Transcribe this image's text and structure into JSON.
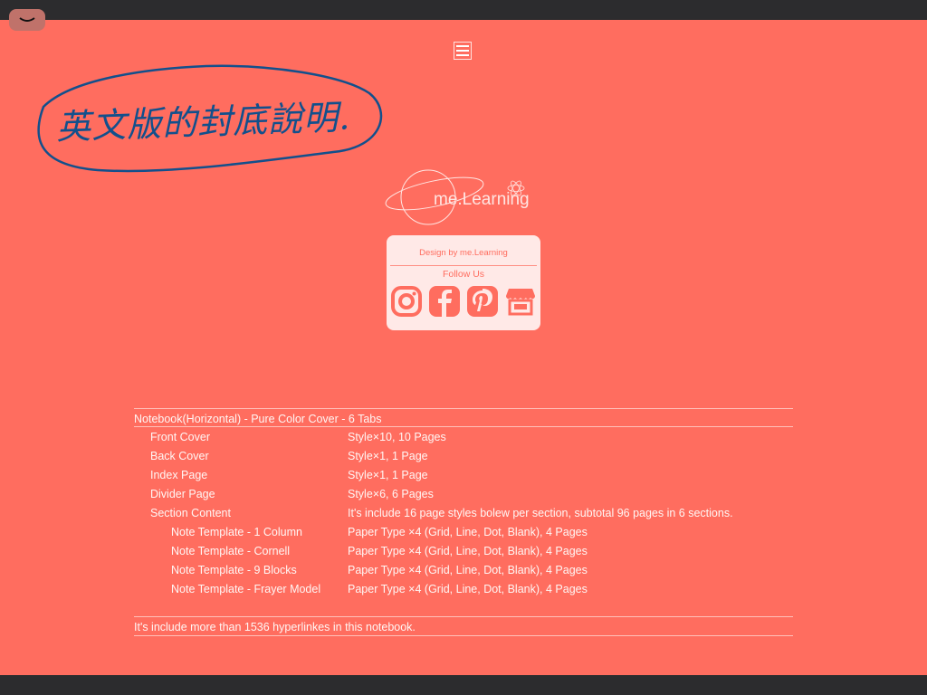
{
  "annotation": {
    "text": "英文版的封底說明.",
    "color": "#12508c"
  },
  "brand": {
    "logo_text": "me.Learning"
  },
  "card": {
    "design_by": "Design by me.Learning",
    "follow": "Follow Us",
    "icons": [
      "instagram-icon",
      "facebook-icon",
      "pinterest-icon",
      "shop-icon"
    ]
  },
  "spec": {
    "title": "Notebook(Horizontal) - Pure Color Cover - 6 Tabs",
    "rows": [
      {
        "k": "Front Cover",
        "v": "Style×10, 10 Pages"
      },
      {
        "k": "Back Cover",
        "v": "Style×1, 1 Page"
      },
      {
        "k": "Index Page",
        "v": "Style×1, 1 Page"
      },
      {
        "k": "Divider Page",
        "v": "Style×6, 6 Pages"
      },
      {
        "k": "Section Content",
        "v": "It's include 16 page styles bolew per section, subtotal 96 pages in 6 sections."
      },
      {
        "k": "Note Template - 1 Column",
        "v": "Paper Type ×4 (Grid, Line, Dot, Blank), 4 Pages"
      },
      {
        "k": "Note Template - Cornell",
        "v": "Paper Type ×4 (Grid, Line, Dot, Blank), 4 Pages"
      },
      {
        "k": "Note Template - 9 Blocks",
        "v": "Paper Type ×4 (Grid, Line, Dot, Blank), 4 Pages"
      },
      {
        "k": "Note Template - Frayer Model",
        "v": "Paper Type ×4 (Grid, Line, Dot, Blank), 4 Pages"
      }
    ],
    "footer": "It's include more than 1536 hyperlinkes in this notebook."
  },
  "colors": {
    "background": "#ff6d5f",
    "bar": "#2c2c2e",
    "card": "#ffe9e7"
  }
}
